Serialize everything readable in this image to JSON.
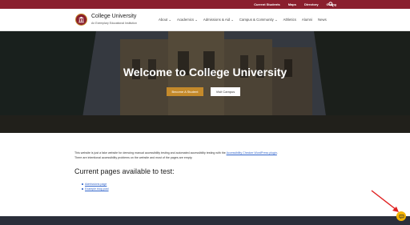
{
  "topbar": {
    "links": [
      "Current Students",
      "Maps",
      "Directory",
      "Giving"
    ],
    "search_icon": "search-icon",
    "background": "#8a1f2e"
  },
  "header": {
    "site_title": "College University",
    "tagline": "An Exemplary Educational Institution",
    "logo_icon": "university-seal-icon",
    "nav": [
      "About ⌄",
      "Academics ⌄",
      "Admissions & Aid ⌄",
      "Campus & Community ⌄",
      "Athletics",
      "Alumni",
      "News"
    ]
  },
  "hero": {
    "title": "Welcome to College University",
    "primary_button": "Become A Student",
    "secondary_button": "Visit Campus"
  },
  "content": {
    "intro_before_link": "This website is just a fake website for demoing manual accessibility testing and automated accessibility testing with the ",
    "intro_link": "Accessibility Checker WordPress plugin",
    "intro_after_link": ".",
    "intro_line2": "There are intentional accessibility problems on the website and most of the pages are empty.",
    "heading": "Current pages available to test:",
    "pages": [
      "Admissions page",
      "Example blog post"
    ]
  },
  "help_widget": {
    "icon": "chat-icon",
    "color": "#f5b400"
  },
  "colors": {
    "brand": "#8a1f2e",
    "accent": "#c48a2b",
    "link": "#3366cc",
    "footer": "#2a2e3a",
    "annotation": "#e02020"
  }
}
